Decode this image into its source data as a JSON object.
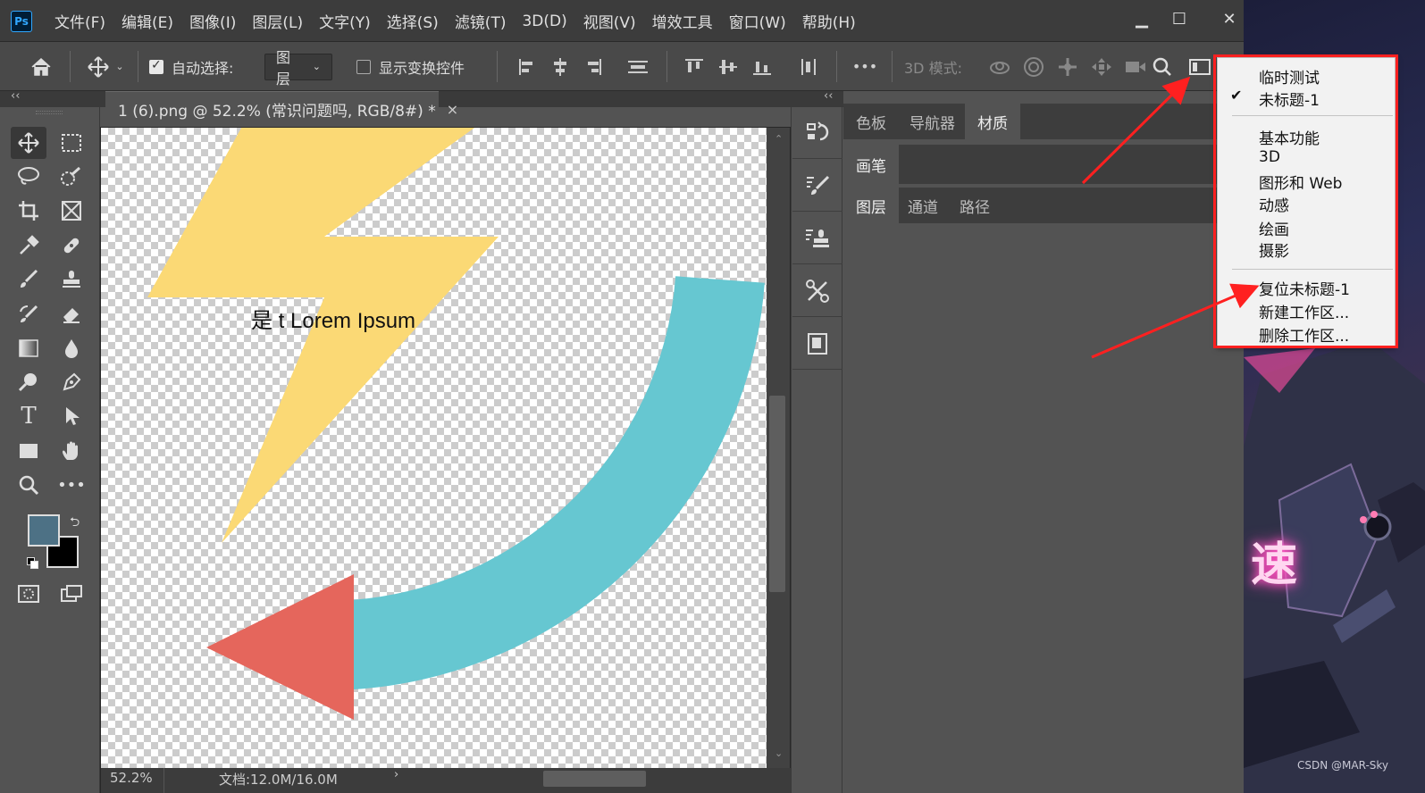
{
  "app": {
    "logo": "Ps"
  },
  "menu": [
    "文件(F)",
    "编辑(E)",
    "图像(I)",
    "图层(L)",
    "文字(Y)",
    "选择(S)",
    "滤镜(T)",
    "3D(D)",
    "视图(V)",
    "增效工具",
    "窗口(W)",
    "帮助(H)"
  ],
  "window": {
    "minimize": "▁",
    "maximize": "☐",
    "close": "✕"
  },
  "options": {
    "auto_select_label": "自动选择:",
    "layer_select_value": "图层",
    "show_transform_label": "显示变换控件",
    "more": "•••",
    "mode_3d_label": "3D 模式:"
  },
  "document": {
    "tab_title": "1 (6).png @ 52.2% (常识问题吗, RGB/8#) *",
    "close": "×",
    "canvas_text": "是 t Lorem Ipsum"
  },
  "colors": {
    "foreground": "#4d7185",
    "background": "#000000",
    "bolt": "#fbd975",
    "arc": "#66c7d1",
    "arrow": "#e5665c",
    "accent_red": "#ff2020"
  },
  "status": {
    "zoom": "52.2%",
    "doc_size": "文档:12.0M/16.0M"
  },
  "panels": {
    "collapse_left": "‹‹",
    "collapse_right": "‹‹",
    "group1_tabs": [
      "色板",
      "导航器",
      "材质"
    ],
    "group2_tabs": [
      "画笔"
    ],
    "group3_tabs": [
      "图层",
      "通道",
      "路径"
    ]
  },
  "workspace_menu": {
    "items_top": [
      "临时测试",
      "未标题-1"
    ],
    "checked_item": "✔",
    "items_mid": [
      "基本功能",
      "3D",
      "图形和 Web",
      "动感",
      "绘画",
      "摄影"
    ],
    "items_bottom": [
      "复位未标题-1",
      "新建工作区...",
      "删除工作区..."
    ]
  },
  "wallpaper": {
    "glyph": "速",
    "watermark": "CSDN @MAR-Sky"
  },
  "icons": [
    "home-icon",
    "move-icon",
    "align-left-icon",
    "align-center-icon",
    "align-right-icon",
    "distribute-icon",
    "orbit-3d-icon",
    "roll-3d-icon",
    "drag-3d-icon",
    "slide-3d-icon",
    "camera-3d-icon",
    "search-icon",
    "workspace-icon",
    "history-icon",
    "brush-settings-icon",
    "clone-source-icon",
    "tool-presets-icon",
    "properties-icon"
  ]
}
